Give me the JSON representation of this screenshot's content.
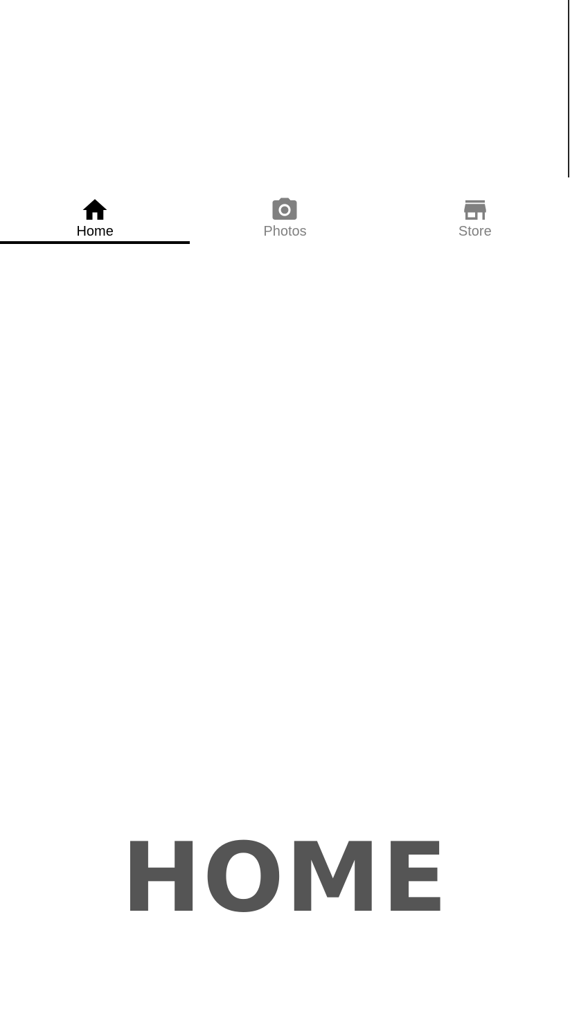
{
  "tabs": [
    {
      "label": "Home",
      "icon": "home-icon",
      "active": true
    },
    {
      "label": "Photos",
      "icon": "camera-icon",
      "active": false
    },
    {
      "label": "Store",
      "icon": "store-icon",
      "active": false
    }
  ],
  "main": {
    "heading": "HOME"
  },
  "colors": {
    "active": "#000000",
    "inactive": "#808080",
    "heading": "#555555"
  }
}
